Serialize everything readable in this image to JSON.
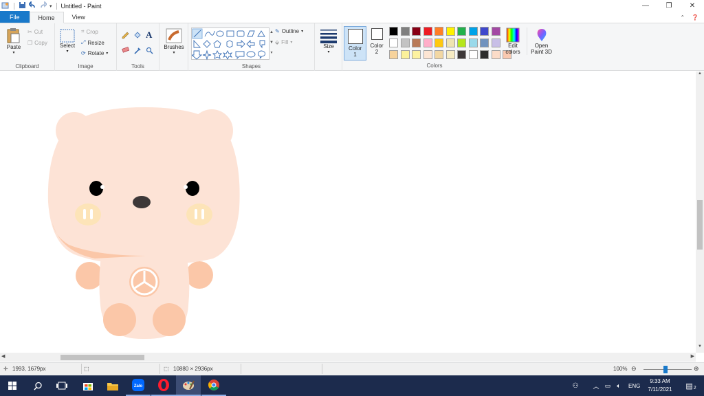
{
  "window": {
    "title": "Untitled - Paint",
    "controls": {
      "minimize": "—",
      "restore": "❐",
      "close": "✕"
    }
  },
  "tabs": [
    {
      "label": "File"
    },
    {
      "label": "Home"
    },
    {
      "label": "View"
    }
  ],
  "ribbon": {
    "clipboard": {
      "label": "Clipboard",
      "paste": "Paste",
      "cut": "Cut",
      "copy": "Copy"
    },
    "image": {
      "label": "Image",
      "select": "Select",
      "crop": "Crop",
      "resize": "Resize",
      "rotate": "Rotate"
    },
    "tools": {
      "label": "Tools",
      "text_glyph": "A"
    },
    "brushes": {
      "label": "Brushes"
    },
    "shapes": {
      "label": "Shapes",
      "outline": "Outline",
      "fill": "Fill"
    },
    "size": {
      "label": "Size"
    },
    "color1": {
      "label": "Color",
      "num": "1",
      "value": "#ffffff"
    },
    "color2": {
      "label": "Color",
      "num": "2",
      "value": "#ffffff"
    },
    "colors": {
      "label": "Colors",
      "row1": [
        "#000000",
        "#7f7f7f",
        "#880015",
        "#ed1c24",
        "#ff7f27",
        "#fff200",
        "#22b14c",
        "#00a2e8",
        "#3f48cc",
        "#a349a4"
      ],
      "row2": [
        "#ffffff",
        "#c3c3c3",
        "#b97a57",
        "#ffaec9",
        "#ffc90e",
        "#efe4b0",
        "#b5e61d",
        "#99d9ea",
        "#7092be",
        "#c8bfe7"
      ],
      "row3": [
        "#f7d39c",
        "#fbf19a",
        "#fdf2a0",
        "#fde5d3",
        "#f2d7a3",
        "#f7ecc4",
        "#3d3838",
        "#ffffff",
        "#2d2d2d",
        "#fcdcc8",
        "#f9c9b0"
      ]
    },
    "edit_colors": {
      "line1": "Edit",
      "line2": "colors"
    },
    "open3d": {
      "line1": "Open",
      "line2": "Paint 3D"
    }
  },
  "status": {
    "cursor_pos": "1993, 1679px",
    "image_size": "10880 × 2936px",
    "zoom": "100%"
  },
  "taskbar": {
    "apps": [
      "start",
      "search",
      "task-view",
      "store",
      "file-explorer",
      "zalo",
      "opera",
      "paint",
      "chrome"
    ],
    "lang": "ENG",
    "time": "9:33 AM",
    "date": "7/11/2021",
    "notifications": "2"
  }
}
